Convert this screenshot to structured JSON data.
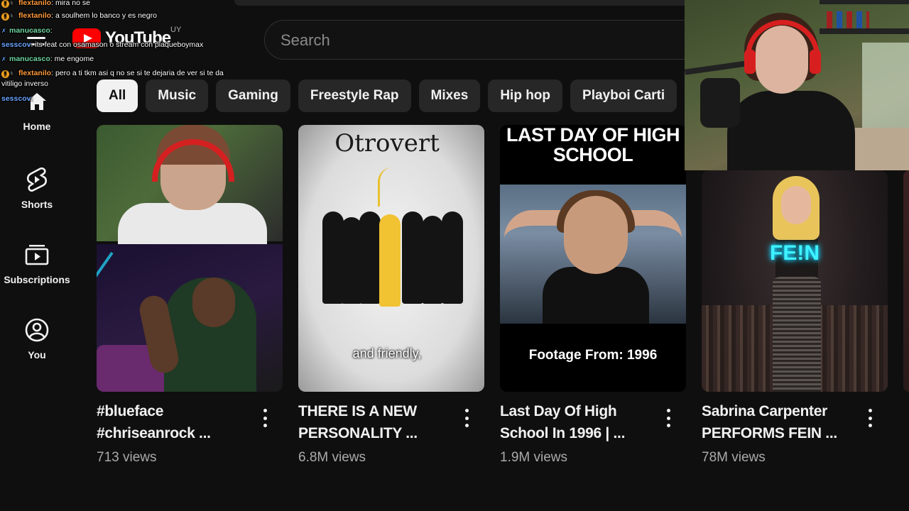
{
  "header": {
    "logo_text": "YouTube",
    "region": "UY",
    "search_placeholder": "Search"
  },
  "sidebar": {
    "items": [
      {
        "label": "Home",
        "icon": "home-icon"
      },
      {
        "label": "Shorts",
        "icon": "shorts-icon"
      },
      {
        "label": "Subscriptions",
        "icon": "subscriptions-icon"
      },
      {
        "label": "You",
        "icon": "account-icon"
      }
    ]
  },
  "chips": [
    "All",
    "Music",
    "Gaming",
    "Freestyle Rap",
    "Mixes",
    "Hip hop",
    "Playboi Carti"
  ],
  "videos": [
    {
      "title": "#blueface #chriseanrock ...",
      "views": "713 views"
    },
    {
      "title": "THERE IS A NEW PERSONALITY ...",
      "views": "6.8M views",
      "thumb_title": "Otrovert",
      "thumb_caption": "and friendly,"
    },
    {
      "title": "Last Day Of High School In 1996 | ...",
      "views": "1.9M views",
      "thumb_title": "LAST DAY OF HIGH SCHOOL",
      "thumb_caption": "Footage From: 1996"
    },
    {
      "title": "Sabrina Carpenter PERFORMS FEIN ...",
      "views": "78M views",
      "thumb_text": "FE!N"
    }
  ],
  "chat": [
    {
      "user": "flextanilo",
      "text": "mira no se",
      "color": "orange"
    },
    {
      "user": "flextanilo",
      "text": "a soulhem lo banco y es negro",
      "color": "orange"
    },
    {
      "user": "manucasco",
      "text": "",
      "color": "green"
    },
    {
      "user": "sesscov",
      "text": "its feat con osamason o stream con plaqueboymax",
      "color": "blue"
    },
    {
      "user": "manucasco",
      "text": "me engome",
      "color": "green"
    },
    {
      "user": "flextanilo",
      "text": "pero a ti tkm asi q no se si te dejaria de ver si te da vitiligo inverso",
      "color": "orange"
    },
    {
      "user": "sesscov",
      "text": "",
      "color": "blue"
    }
  ],
  "colors": {
    "background": "#0f0f0f",
    "chip_bg": "#272727",
    "chip_active_bg": "#f1f1f1",
    "brand_red": "#ff0000",
    "secondary_text": "#aaaaaa"
  }
}
